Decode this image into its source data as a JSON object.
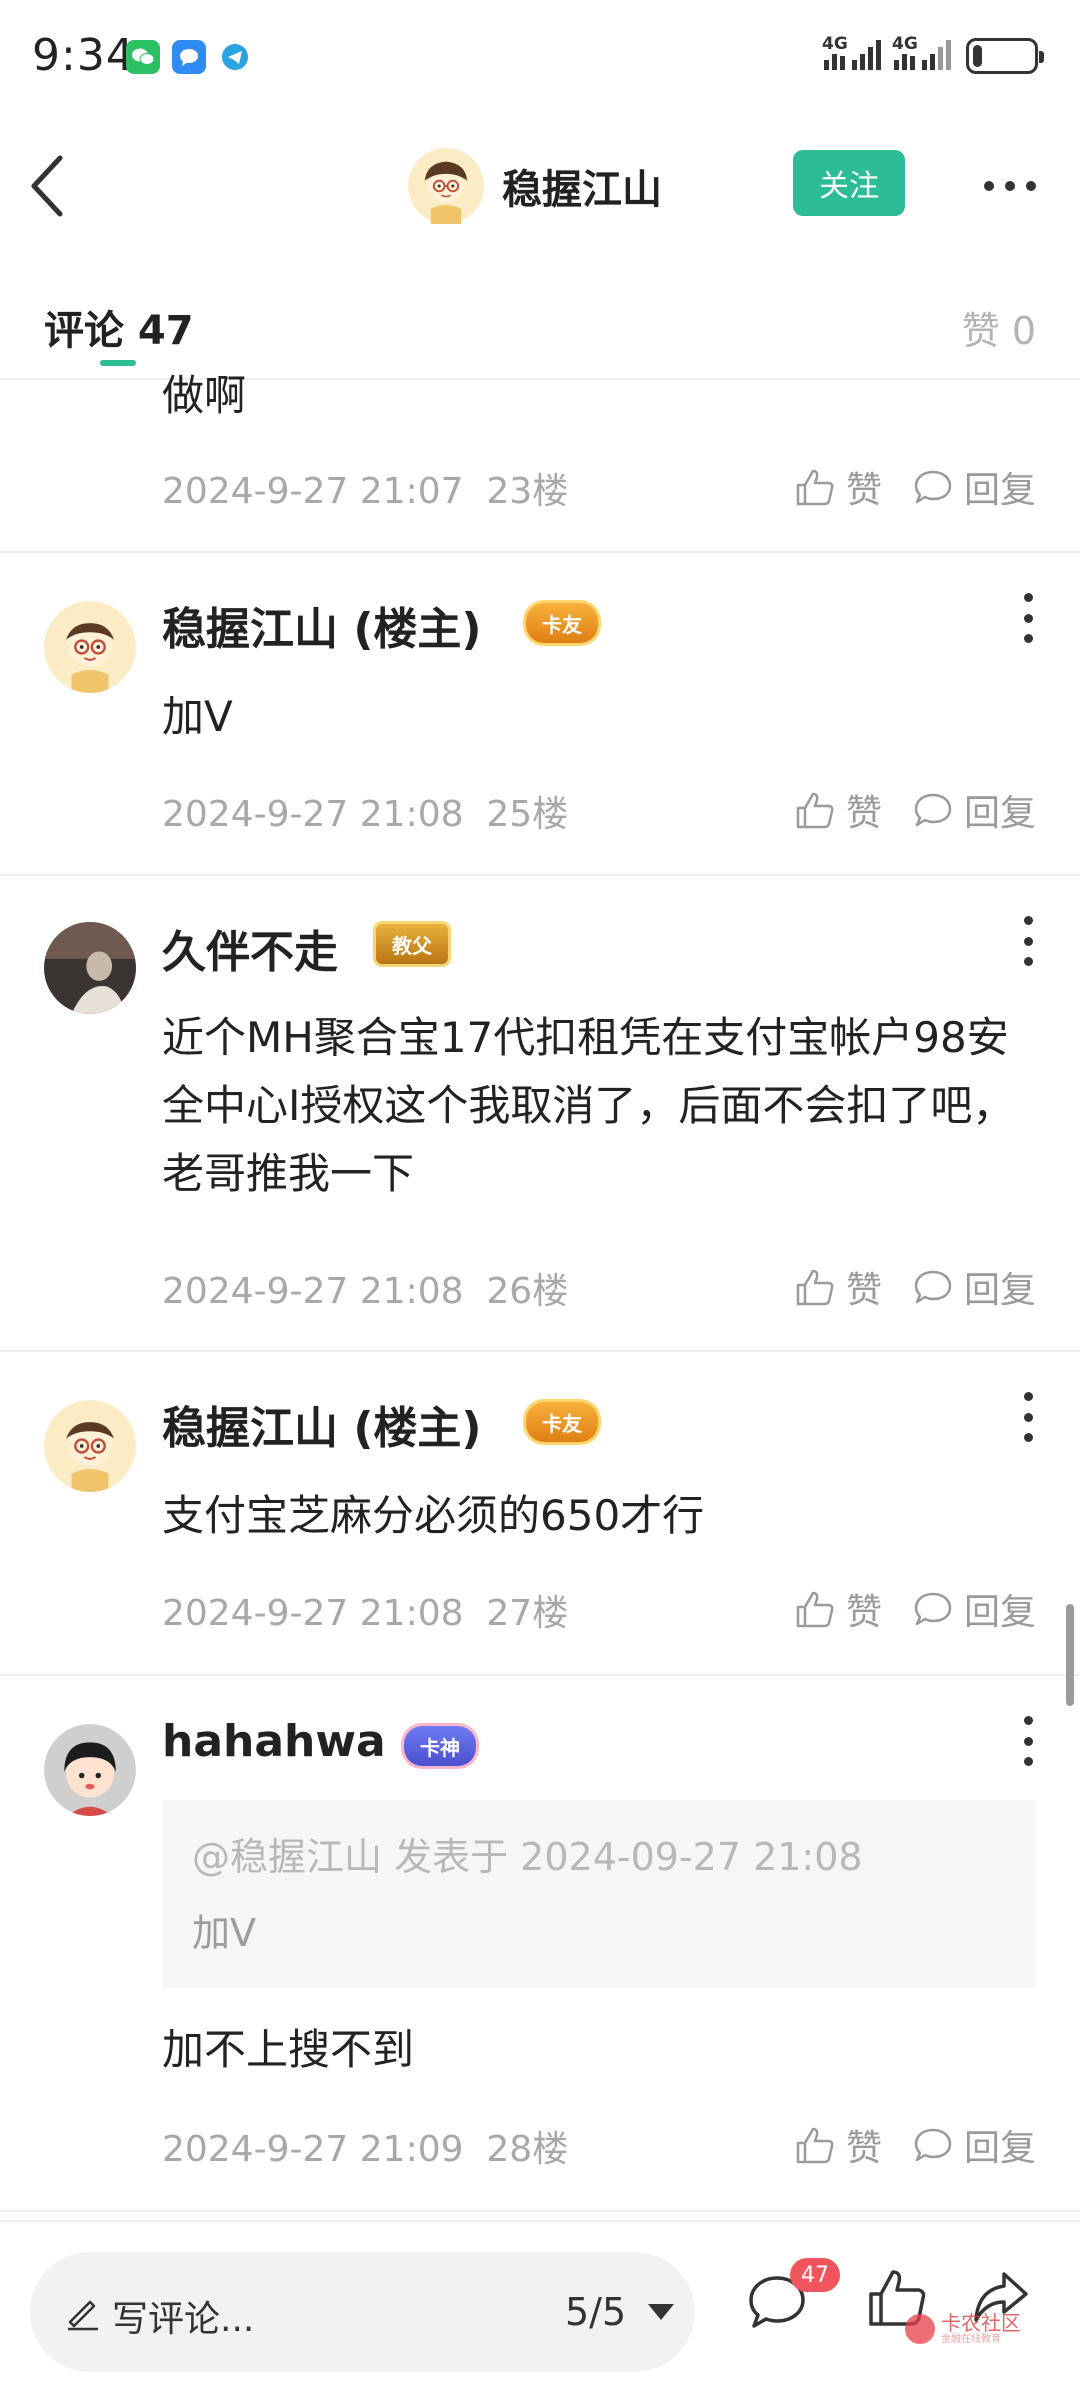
{
  "status_bar": {
    "time": "9:34",
    "icons": [
      "wechat-icon",
      "message-icon",
      "telegram-icon"
    ],
    "signal1_label": "4G",
    "signal2_label": "4G",
    "battery_level": 0.15
  },
  "header": {
    "author_name": "稳握江山",
    "follow_label": "关注"
  },
  "tabs": {
    "comments_label": "评论 47",
    "likes_label": "赞 0"
  },
  "partial_comment": {
    "text": "做啊",
    "date": "2024-9-27 21:07",
    "floor": "23楼"
  },
  "actions": {
    "like_label": "赞",
    "reply_label": "回复"
  },
  "comments": [
    {
      "name": "稳握江山 (楼主)",
      "badge": "卡友",
      "text": "加V",
      "date": "2024-9-27 21:08",
      "floor": "25楼"
    },
    {
      "name": "久伴不走",
      "badge": "教父",
      "text": "近个MH聚合宝17代扣租凭在支付宝帐户98安全中心I授权这个我取消了，后面不会扣了吧，老哥推我一下",
      "date": "2024-9-27 21:08",
      "floor": "26楼"
    },
    {
      "name": "稳握江山 (楼主)",
      "badge": "卡友",
      "text": "支付宝芝麻分必须的650才行",
      "date": "2024-9-27 21:08",
      "floor": "27楼"
    },
    {
      "name": "hahahwa",
      "badge": "卡神",
      "quote_header": "@稳握江山 发表于 2024-09-27 21:08",
      "quote_text": "加V",
      "text": "加不上搜不到",
      "date": "2024-9-27 21:09",
      "floor": "28楼"
    }
  ],
  "bottom_bar": {
    "write_placeholder": "写评论...",
    "page_indicator": "5/5",
    "comment_count": "47",
    "watermark_main": "卡农社区",
    "watermark_sub": "金融在线教育"
  },
  "colors": {
    "accent": "#2dbd96",
    "badge_red": "#f0555e",
    "meta_gray": "#a8a8a8"
  }
}
